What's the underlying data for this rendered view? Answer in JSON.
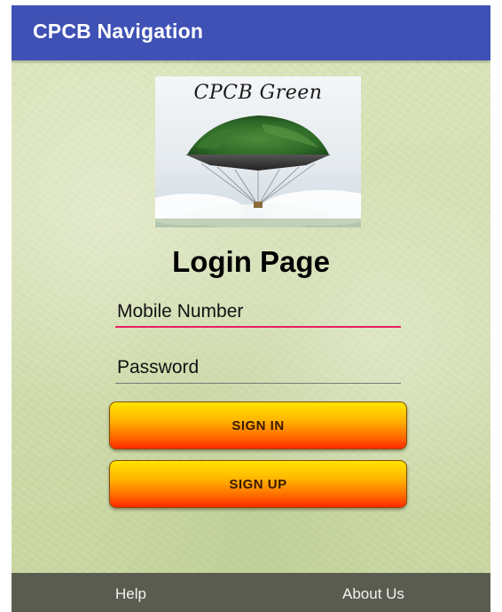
{
  "appbar": {
    "title": "CPCB Navigation"
  },
  "logo": {
    "text": "CPCB Green",
    "icon": "floating-island-balloon-image"
  },
  "login": {
    "page_title": "Login Page",
    "mobile_placeholder": "Mobile Number",
    "password_placeholder": "Password",
    "signin_label": "SIGN IN",
    "signup_label": "SIGN UP"
  },
  "bottom_nav": {
    "help_label": "Help",
    "about_label": "About Us"
  },
  "colors": {
    "appbar": "#3f51b5",
    "mobile_underline": "#e91e63",
    "button_top": "#ffe500",
    "button_bottom": "#ff2a00",
    "bottom_bar": "#5b5c50"
  }
}
